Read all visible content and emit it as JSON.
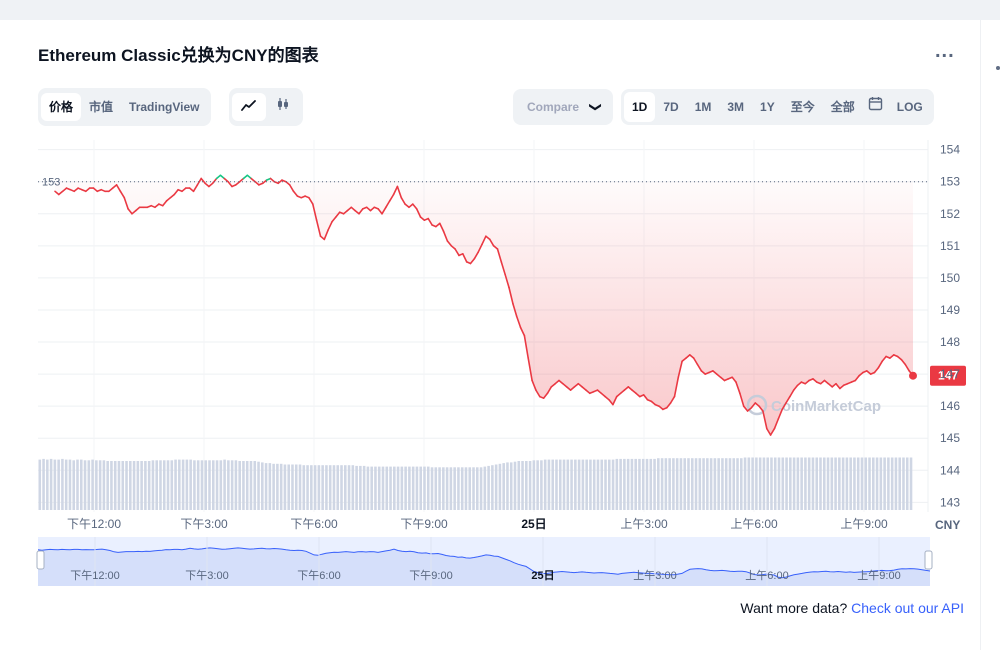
{
  "title": "Ethereum Classic兑换为CNY的图表",
  "more_label": "...",
  "tabs_left": [
    "价格",
    "市值",
    "TradingView"
  ],
  "chart_type_icons": [
    "line-chart-icon",
    "candlestick-icon"
  ],
  "compare_label": "Compare",
  "compare_chevron": "❯",
  "range_tabs": [
    "1D",
    "7D",
    "1M",
    "3M",
    "1Y",
    "至今",
    "全部"
  ],
  "calendar_icon": "calendar-icon",
  "log_label": "LOG",
  "footer": {
    "prefix": "Want more data? ",
    "link": "Check out our API"
  },
  "watermark": "CoinMarketCap",
  "colors": {
    "down": "#ea3943",
    "up": "#16c784",
    "fill": "#ea3943",
    "volume": "#cfd6e4",
    "nav": "#d5dffa",
    "nav_line": "#3861fb"
  },
  "chart_data": {
    "type": "line",
    "currency": "CNY",
    "ylim": [
      142.7,
      154.3
    ],
    "yticks": [
      154,
      153,
      152,
      151,
      150,
      149,
      148,
      147,
      146,
      145,
      144,
      143
    ],
    "reference_price": 153,
    "reference_label": "153",
    "current_price_label": "147",
    "xtick_labels": [
      "下午12:00",
      "下午3:00",
      "下午6:00",
      "下午9:00",
      "25日",
      "上午3:00",
      "上午6:00",
      "上午9:00"
    ],
    "x_axis_unit": "CNY",
    "price": [
      152.7,
      152.6,
      152.7,
      152.8,
      152.75,
      152.7,
      152.8,
      152.75,
      152.7,
      152.8,
      152.8,
      152.7,
      152.75,
      152.7,
      152.7,
      152.8,
      152.9,
      152.7,
      152.5,
      152.15,
      152.0,
      152.1,
      152.2,
      152.2,
      152.2,
      152.25,
      152.2,
      152.3,
      152.25,
      152.4,
      152.5,
      152.6,
      152.75,
      152.7,
      152.8,
      152.8,
      152.7,
      152.9,
      153.1,
      152.95,
      152.85,
      152.95,
      153.1,
      153.2,
      153.1,
      153.0,
      152.85,
      152.9,
      153.0,
      153.1,
      153.2,
      153.1,
      153.0,
      152.9,
      152.95,
      153.05,
      153.1,
      153.0,
      152.95,
      153.05,
      153.0,
      152.9,
      152.7,
      152.55,
      152.5,
      152.55,
      152.5,
      152.3,
      151.8,
      151.3,
      151.2,
      151.5,
      151.75,
      151.9,
      152.05,
      152.0,
      152.1,
      152.2,
      152.1,
      152.0,
      152.15,
      152.2,
      152.1,
      152.2,
      152.15,
      152.0,
      152.2,
      152.4,
      152.6,
      152.85,
      152.5,
      152.3,
      152.2,
      152.3,
      152.15,
      151.9,
      151.8,
      151.85,
      151.65,
      151.6,
      151.7,
      151.45,
      151.15,
      151.0,
      150.9,
      150.7,
      150.75,
      150.5,
      150.45,
      150.6,
      150.8,
      151.05,
      151.3,
      151.2,
      151.0,
      150.9,
      150.5,
      150.1,
      149.7,
      149.2,
      148.8,
      148.45,
      148.2,
      147.5,
      146.8,
      146.5,
      146.3,
      146.25,
      146.4,
      146.6,
      146.7,
      146.8,
      146.7,
      146.6,
      146.5,
      146.6,
      146.7,
      146.6,
      146.5,
      146.4,
      146.45,
      146.5,
      146.4,
      146.3,
      146.2,
      146.05,
      146.3,
      146.4,
      146.5,
      146.6,
      146.5,
      146.4,
      146.3,
      146.35,
      146.2,
      146.15,
      146.05,
      146.0,
      145.9,
      145.95,
      146.1,
      146.3,
      146.9,
      147.4,
      147.5,
      147.6,
      147.5,
      147.3,
      147.1,
      147.0,
      147.05,
      147.1,
      147.0,
      146.9,
      146.8,
      146.85,
      146.9,
      146.75,
      146.4,
      146.0,
      145.85,
      145.95,
      146.1,
      146.0,
      145.85,
      145.3,
      145.1,
      145.3,
      145.6,
      145.9,
      146.1,
      146.3,
      146.5,
      146.65,
      146.75,
      146.7,
      146.8,
      146.85,
      146.75,
      146.7,
      146.8,
      146.7,
      146.6,
      146.7,
      146.55,
      146.65,
      146.7,
      146.75,
      146.8,
      146.95,
      147.05,
      147.1,
      147.0,
      147.05,
      147.2,
      147.4,
      147.55,
      147.5,
      147.6,
      147.55,
      147.45,
      147.3,
      147.1,
      146.95
    ],
    "volume": [
      0.72,
      0.73,
      0.72,
      0.73,
      0.72,
      0.72,
      0.73,
      0.72,
      0.72,
      0.71,
      0.72,
      0.72,
      0.71,
      0.71,
      0.72,
      0.71,
      0.71,
      0.71,
      0.7,
      0.7,
      0.7,
      0.7,
      0.7,
      0.7,
      0.7,
      0.7,
      0.7,
      0.7,
      0.7,
      0.7,
      0.71,
      0.71,
      0.71,
      0.71,
      0.71,
      0.71,
      0.72,
      0.72,
      0.72,
      0.72,
      0.72,
      0.71,
      0.71,
      0.71,
      0.71,
      0.71,
      0.71,
      0.71,
      0.71,
      0.72,
      0.71,
      0.71,
      0.71,
      0.7,
      0.7,
      0.7,
      0.7,
      0.7,
      0.69,
      0.68,
      0.67,
      0.67,
      0.66,
      0.66,
      0.66,
      0.65,
      0.65,
      0.65,
      0.65,
      0.65,
      0.64,
      0.64,
      0.64,
      0.64,
      0.64,
      0.64,
      0.64,
      0.64,
      0.64,
      0.64,
      0.64,
      0.64,
      0.64,
      0.64,
      0.63,
      0.63,
      0.63,
      0.62,
      0.62,
      0.62,
      0.62,
      0.62,
      0.62,
      0.62,
      0.62,
      0.62,
      0.62,
      0.62,
      0.62,
      0.62,
      0.62,
      0.62,
      0.62,
      0.62,
      0.61,
      0.61,
      0.61,
      0.61,
      0.61,
      0.61,
      0.61,
      0.61,
      0.61,
      0.61,
      0.61,
      0.61,
      0.61,
      0.61,
      0.62,
      0.63,
      0.64,
      0.65,
      0.66,
      0.67,
      0.68,
      0.68,
      0.69,
      0.7,
      0.7,
      0.7,
      0.7,
      0.71,
      0.71,
      0.71,
      0.72,
      0.72,
      0.72,
      0.72,
      0.72,
      0.72,
      0.72,
      0.72,
      0.72,
      0.72,
      0.72,
      0.72,
      0.72,
      0.72,
      0.72,
      0.72,
      0.72,
      0.72,
      0.72,
      0.73,
      0.73,
      0.73,
      0.73,
      0.73,
      0.73,
      0.73,
      0.73,
      0.73,
      0.73,
      0.73,
      0.74,
      0.74,
      0.74,
      0.74,
      0.74,
      0.74,
      0.74,
      0.74,
      0.74,
      0.74,
      0.74,
      0.74,
      0.74,
      0.74,
      0.74,
      0.74,
      0.74,
      0.74,
      0.74,
      0.74,
      0.74,
      0.74,
      0.74,
      0.75,
      0.75,
      0.75,
      0.75,
      0.75,
      0.75,
      0.75,
      0.75,
      0.75,
      0.75,
      0.75,
      0.75,
      0.75,
      0.75,
      0.75,
      0.75,
      0.75,
      0.75,
      0.75,
      0.75,
      0.75,
      0.75,
      0.75,
      0.75,
      0.75,
      0.75,
      0.75,
      0.75,
      0.75,
      0.75,
      0.75,
      0.75,
      0.75,
      0.75,
      0.75,
      0.75,
      0.75,
      0.75,
      0.75,
      0.75,
      0.75,
      0.75,
      0.75,
      0.75,
      0.75
    ],
    "navigator_labels": [
      "下午12:00",
      "下午3:00",
      "下午6:00",
      "下午9:00",
      "25日",
      "上午3:00",
      "上午6:00",
      "上午9:00"
    ]
  }
}
